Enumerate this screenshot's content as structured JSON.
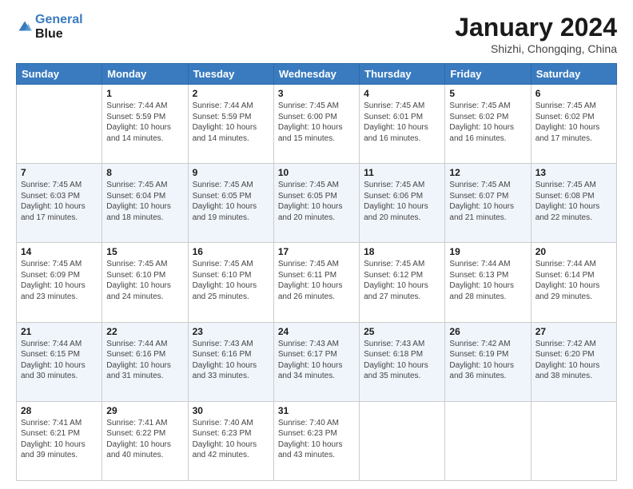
{
  "logo": {
    "line1": "General",
    "line2": "Blue"
  },
  "title": "January 2024",
  "subtitle": "Shizhi, Chongqing, China",
  "headers": [
    "Sunday",
    "Monday",
    "Tuesday",
    "Wednesday",
    "Thursday",
    "Friday",
    "Saturday"
  ],
  "weeks": [
    [
      {
        "day": "",
        "sunrise": "",
        "sunset": "",
        "daylight": ""
      },
      {
        "day": "1",
        "sunrise": "Sunrise: 7:44 AM",
        "sunset": "Sunset: 5:59 PM",
        "daylight": "Daylight: 10 hours and 14 minutes."
      },
      {
        "day": "2",
        "sunrise": "Sunrise: 7:44 AM",
        "sunset": "Sunset: 5:59 PM",
        "daylight": "Daylight: 10 hours and 14 minutes."
      },
      {
        "day": "3",
        "sunrise": "Sunrise: 7:45 AM",
        "sunset": "Sunset: 6:00 PM",
        "daylight": "Daylight: 10 hours and 15 minutes."
      },
      {
        "day": "4",
        "sunrise": "Sunrise: 7:45 AM",
        "sunset": "Sunset: 6:01 PM",
        "daylight": "Daylight: 10 hours and 16 minutes."
      },
      {
        "day": "5",
        "sunrise": "Sunrise: 7:45 AM",
        "sunset": "Sunset: 6:02 PM",
        "daylight": "Daylight: 10 hours and 16 minutes."
      },
      {
        "day": "6",
        "sunrise": "Sunrise: 7:45 AM",
        "sunset": "Sunset: 6:02 PM",
        "daylight": "Daylight: 10 hours and 17 minutes."
      }
    ],
    [
      {
        "day": "7",
        "sunrise": "Sunrise: 7:45 AM",
        "sunset": "Sunset: 6:03 PM",
        "daylight": "Daylight: 10 hours and 17 minutes."
      },
      {
        "day": "8",
        "sunrise": "Sunrise: 7:45 AM",
        "sunset": "Sunset: 6:04 PM",
        "daylight": "Daylight: 10 hours and 18 minutes."
      },
      {
        "day": "9",
        "sunrise": "Sunrise: 7:45 AM",
        "sunset": "Sunset: 6:05 PM",
        "daylight": "Daylight: 10 hours and 19 minutes."
      },
      {
        "day": "10",
        "sunrise": "Sunrise: 7:45 AM",
        "sunset": "Sunset: 6:05 PM",
        "daylight": "Daylight: 10 hours and 20 minutes."
      },
      {
        "day": "11",
        "sunrise": "Sunrise: 7:45 AM",
        "sunset": "Sunset: 6:06 PM",
        "daylight": "Daylight: 10 hours and 20 minutes."
      },
      {
        "day": "12",
        "sunrise": "Sunrise: 7:45 AM",
        "sunset": "Sunset: 6:07 PM",
        "daylight": "Daylight: 10 hours and 21 minutes."
      },
      {
        "day": "13",
        "sunrise": "Sunrise: 7:45 AM",
        "sunset": "Sunset: 6:08 PM",
        "daylight": "Daylight: 10 hours and 22 minutes."
      }
    ],
    [
      {
        "day": "14",
        "sunrise": "Sunrise: 7:45 AM",
        "sunset": "Sunset: 6:09 PM",
        "daylight": "Daylight: 10 hours and 23 minutes."
      },
      {
        "day": "15",
        "sunrise": "Sunrise: 7:45 AM",
        "sunset": "Sunset: 6:10 PM",
        "daylight": "Daylight: 10 hours and 24 minutes."
      },
      {
        "day": "16",
        "sunrise": "Sunrise: 7:45 AM",
        "sunset": "Sunset: 6:10 PM",
        "daylight": "Daylight: 10 hours and 25 minutes."
      },
      {
        "day": "17",
        "sunrise": "Sunrise: 7:45 AM",
        "sunset": "Sunset: 6:11 PM",
        "daylight": "Daylight: 10 hours and 26 minutes."
      },
      {
        "day": "18",
        "sunrise": "Sunrise: 7:45 AM",
        "sunset": "Sunset: 6:12 PM",
        "daylight": "Daylight: 10 hours and 27 minutes."
      },
      {
        "day": "19",
        "sunrise": "Sunrise: 7:44 AM",
        "sunset": "Sunset: 6:13 PM",
        "daylight": "Daylight: 10 hours and 28 minutes."
      },
      {
        "day": "20",
        "sunrise": "Sunrise: 7:44 AM",
        "sunset": "Sunset: 6:14 PM",
        "daylight": "Daylight: 10 hours and 29 minutes."
      }
    ],
    [
      {
        "day": "21",
        "sunrise": "Sunrise: 7:44 AM",
        "sunset": "Sunset: 6:15 PM",
        "daylight": "Daylight: 10 hours and 30 minutes."
      },
      {
        "day": "22",
        "sunrise": "Sunrise: 7:44 AM",
        "sunset": "Sunset: 6:16 PM",
        "daylight": "Daylight: 10 hours and 31 minutes."
      },
      {
        "day": "23",
        "sunrise": "Sunrise: 7:43 AM",
        "sunset": "Sunset: 6:16 PM",
        "daylight": "Daylight: 10 hours and 33 minutes."
      },
      {
        "day": "24",
        "sunrise": "Sunrise: 7:43 AM",
        "sunset": "Sunset: 6:17 PM",
        "daylight": "Daylight: 10 hours and 34 minutes."
      },
      {
        "day": "25",
        "sunrise": "Sunrise: 7:43 AM",
        "sunset": "Sunset: 6:18 PM",
        "daylight": "Daylight: 10 hours and 35 minutes."
      },
      {
        "day": "26",
        "sunrise": "Sunrise: 7:42 AM",
        "sunset": "Sunset: 6:19 PM",
        "daylight": "Daylight: 10 hours and 36 minutes."
      },
      {
        "day": "27",
        "sunrise": "Sunrise: 7:42 AM",
        "sunset": "Sunset: 6:20 PM",
        "daylight": "Daylight: 10 hours and 38 minutes."
      }
    ],
    [
      {
        "day": "28",
        "sunrise": "Sunrise: 7:41 AM",
        "sunset": "Sunset: 6:21 PM",
        "daylight": "Daylight: 10 hours and 39 minutes."
      },
      {
        "day": "29",
        "sunrise": "Sunrise: 7:41 AM",
        "sunset": "Sunset: 6:22 PM",
        "daylight": "Daylight: 10 hours and 40 minutes."
      },
      {
        "day": "30",
        "sunrise": "Sunrise: 7:40 AM",
        "sunset": "Sunset: 6:23 PM",
        "daylight": "Daylight: 10 hours and 42 minutes."
      },
      {
        "day": "31",
        "sunrise": "Sunrise: 7:40 AM",
        "sunset": "Sunset: 6:23 PM",
        "daylight": "Daylight: 10 hours and 43 minutes."
      },
      {
        "day": "",
        "sunrise": "",
        "sunset": "",
        "daylight": ""
      },
      {
        "day": "",
        "sunrise": "",
        "sunset": "",
        "daylight": ""
      },
      {
        "day": "",
        "sunrise": "",
        "sunset": "",
        "daylight": ""
      }
    ]
  ]
}
